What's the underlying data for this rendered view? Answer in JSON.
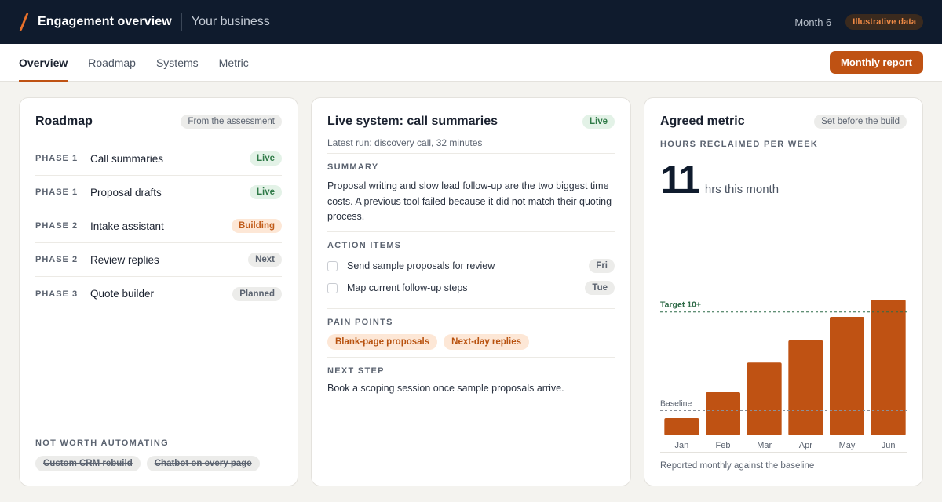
{
  "topbar": {
    "title": "Engagement overview",
    "subtitle": "Your business",
    "month": "Month 6",
    "badge": "Illustrative data"
  },
  "tabs": [
    "Overview",
    "Roadmap",
    "Systems",
    "Metric"
  ],
  "active_tab": "Overview",
  "report_button": "Monthly report",
  "roadmap": {
    "title": "Roadmap",
    "badge": "From the assessment",
    "items": [
      {
        "phase": "PHASE 1",
        "name": "Call summaries",
        "status": "Live"
      },
      {
        "phase": "PHASE 1",
        "name": "Proposal drafts",
        "status": "Live"
      },
      {
        "phase": "PHASE 2",
        "name": "Intake assistant",
        "status": "Building"
      },
      {
        "phase": "PHASE 2",
        "name": "Review replies",
        "status": "Next"
      },
      {
        "phase": "PHASE 3",
        "name": "Quote builder",
        "status": "Planned"
      }
    ],
    "not_worth_label": "NOT WORTH AUTOMATING",
    "not_worth_items": [
      "Custom CRM rebuild",
      "Chatbot on every page"
    ]
  },
  "live": {
    "title": "Live system: call summaries",
    "badge": "Live",
    "latest_run": "Latest run: discovery call, 32 minutes",
    "summary_label": "SUMMARY",
    "summary_text": "Proposal writing and slow lead follow-up are the two biggest time costs. A previous tool failed because it did not match their quoting process.",
    "actions_label": "ACTION ITEMS",
    "actions": [
      {
        "text": "Send sample proposals for review",
        "due": "Fri"
      },
      {
        "text": "Map current follow-up steps",
        "due": "Tue"
      }
    ],
    "pain_label": "PAIN POINTS",
    "pain_points": [
      "Blank-page proposals",
      "Next-day replies"
    ],
    "next_label": "NEXT STEP",
    "next_text": "Book a scoping session once sample proposals arrive."
  },
  "metric": {
    "title": "Agreed metric",
    "badge": "Set before the build",
    "label": "HOURS RECLAIMED PER WEEK",
    "value": "11",
    "unit": "hrs this month",
    "footer": "Reported monthly against the baseline"
  },
  "colors": {
    "bar": "#bf5213",
    "target_line": "#2f6b48",
    "baseline_line": "#8a9099"
  },
  "chart_data": {
    "type": "bar",
    "categories": [
      "Jan",
      "Feb",
      "Mar",
      "Apr",
      "May",
      "Jun"
    ],
    "values": [
      1.4,
      3.5,
      5.9,
      7.7,
      9.6,
      11.0
    ],
    "ylim": [
      0,
      11.0
    ],
    "reference_lines": [
      {
        "label": "Target 10+",
        "value": 10
      },
      {
        "label": "Baseline",
        "value": 2.0
      }
    ]
  }
}
